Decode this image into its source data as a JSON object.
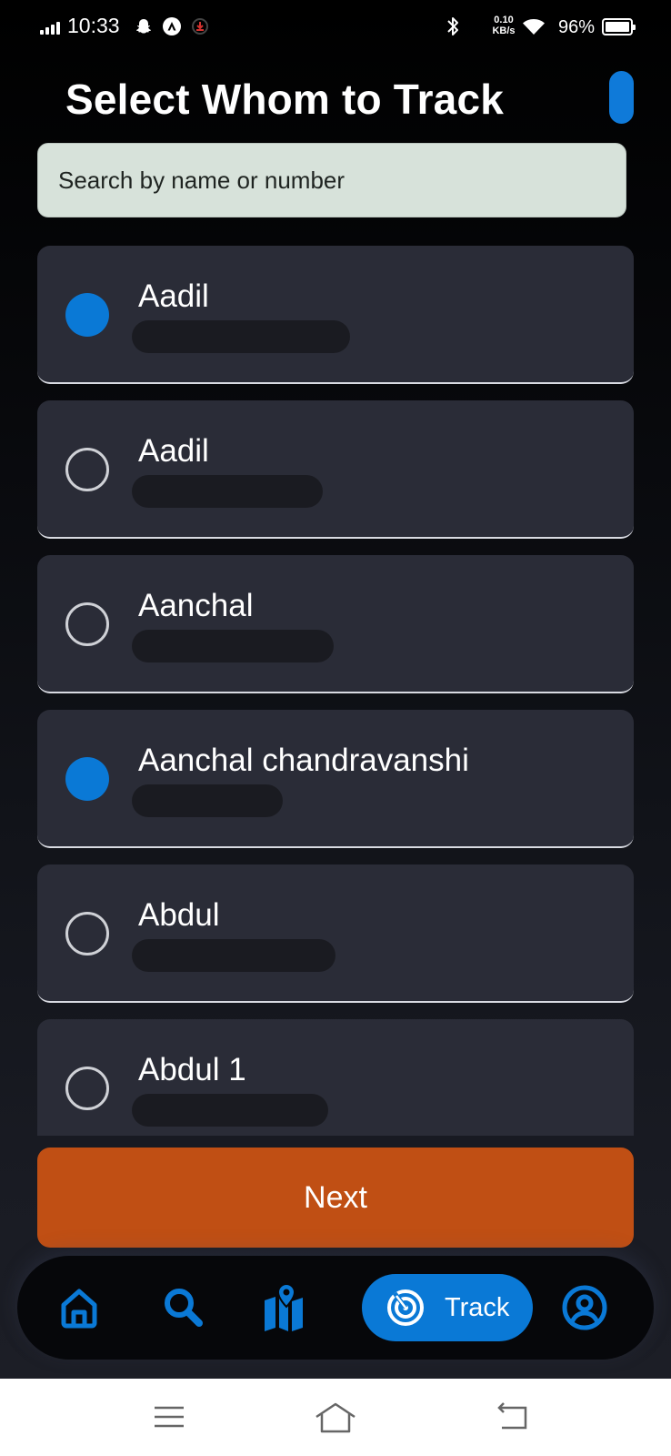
{
  "status_bar": {
    "time": "10:33",
    "speed_value": "0.10",
    "speed_unit": "KB/s",
    "battery": "96%",
    "battery_level": 0.96,
    "icons": [
      "signal-icon",
      "snapchat-icon",
      "app-a-icon",
      "notification-icon",
      "bluetooth-icon",
      "wifi-icon",
      "battery-icon"
    ]
  },
  "header": {
    "title": "Select Whom to Track"
  },
  "search": {
    "placeholder": "Search by name or number"
  },
  "contacts": [
    {
      "name": "Aadil",
      "selected": true
    },
    {
      "name": "Aadil",
      "selected": false
    },
    {
      "name": "Aanchal",
      "selected": false
    },
    {
      "name": "Aanchal chandravanshi",
      "selected": true
    },
    {
      "name": "Abdul",
      "selected": false
    },
    {
      "name": "Abdul 1",
      "selected": false
    }
  ],
  "next_button": {
    "label": "Next"
  },
  "bottom_nav": {
    "items": [
      "home-icon",
      "search-icon",
      "map-icon",
      "track-icon",
      "profile-icon"
    ],
    "active_label": "Track"
  },
  "system_nav": [
    "menu-icon",
    "home-icon",
    "back-icon"
  ],
  "colors": {
    "accent": "#0a79d6",
    "next_button": "#c04f14",
    "card": "#2a2c37",
    "search_bg": "#d7e2da"
  }
}
